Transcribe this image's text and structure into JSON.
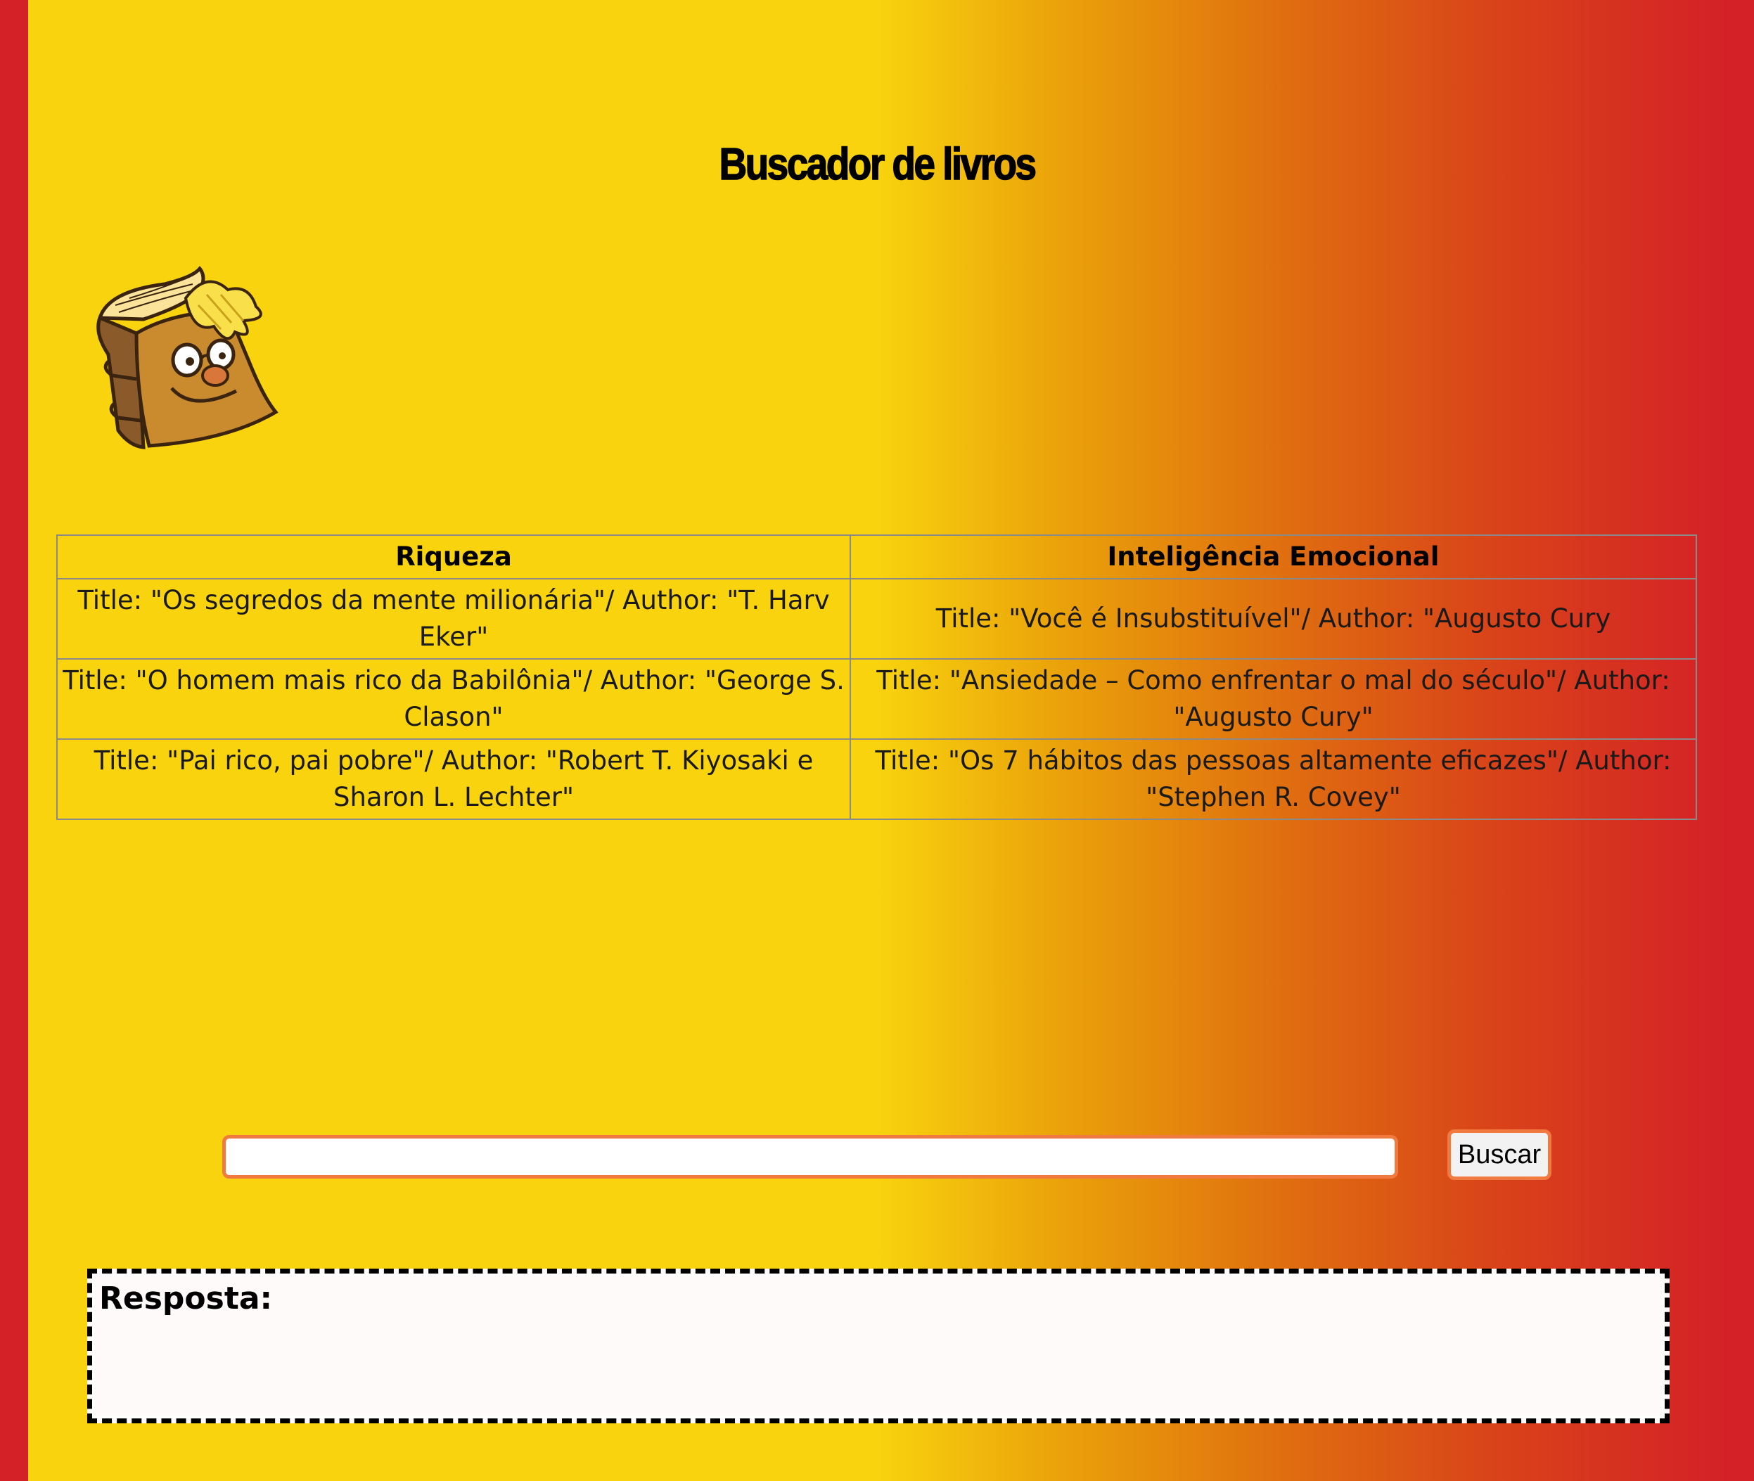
{
  "header": {
    "title": "Buscador de livros"
  },
  "logo": {
    "icon": "book-mascot-icon"
  },
  "table": {
    "headers": [
      "Riqueza",
      "Inteligência Emocional"
    ],
    "rows": [
      [
        "Title: \"Os segredos da mente milionária\"/ Author: \"T. Harv Eker\"",
        "Title: \"Você é Insubstituível\"/ Author: \"Augusto Cury"
      ],
      [
        "Title: \"O homem mais rico da Babilônia\"/ Author: \"George S. Clason\"",
        "Title: \"Ansiedade – Como enfrentar o mal do século\"/ Author: \"Augusto Cury\""
      ],
      [
        "Title: \"Pai rico, pai pobre\"/ Author: \"Robert T. Kiyosaki e Sharon L. Lechter\"",
        "Title: \"Os 7 hábitos das pessoas altamente eficazes\"/ Author: \"Stephen R. Covey\""
      ]
    ]
  },
  "search": {
    "value": "",
    "placeholder": "",
    "button_label": "Buscar"
  },
  "answer": {
    "label": "Resposta:"
  },
  "colors": {
    "side_border": "#d42127",
    "gradient_start": "#f8d30e",
    "gradient_end": "#d42127",
    "input_border": "#f07a40"
  }
}
